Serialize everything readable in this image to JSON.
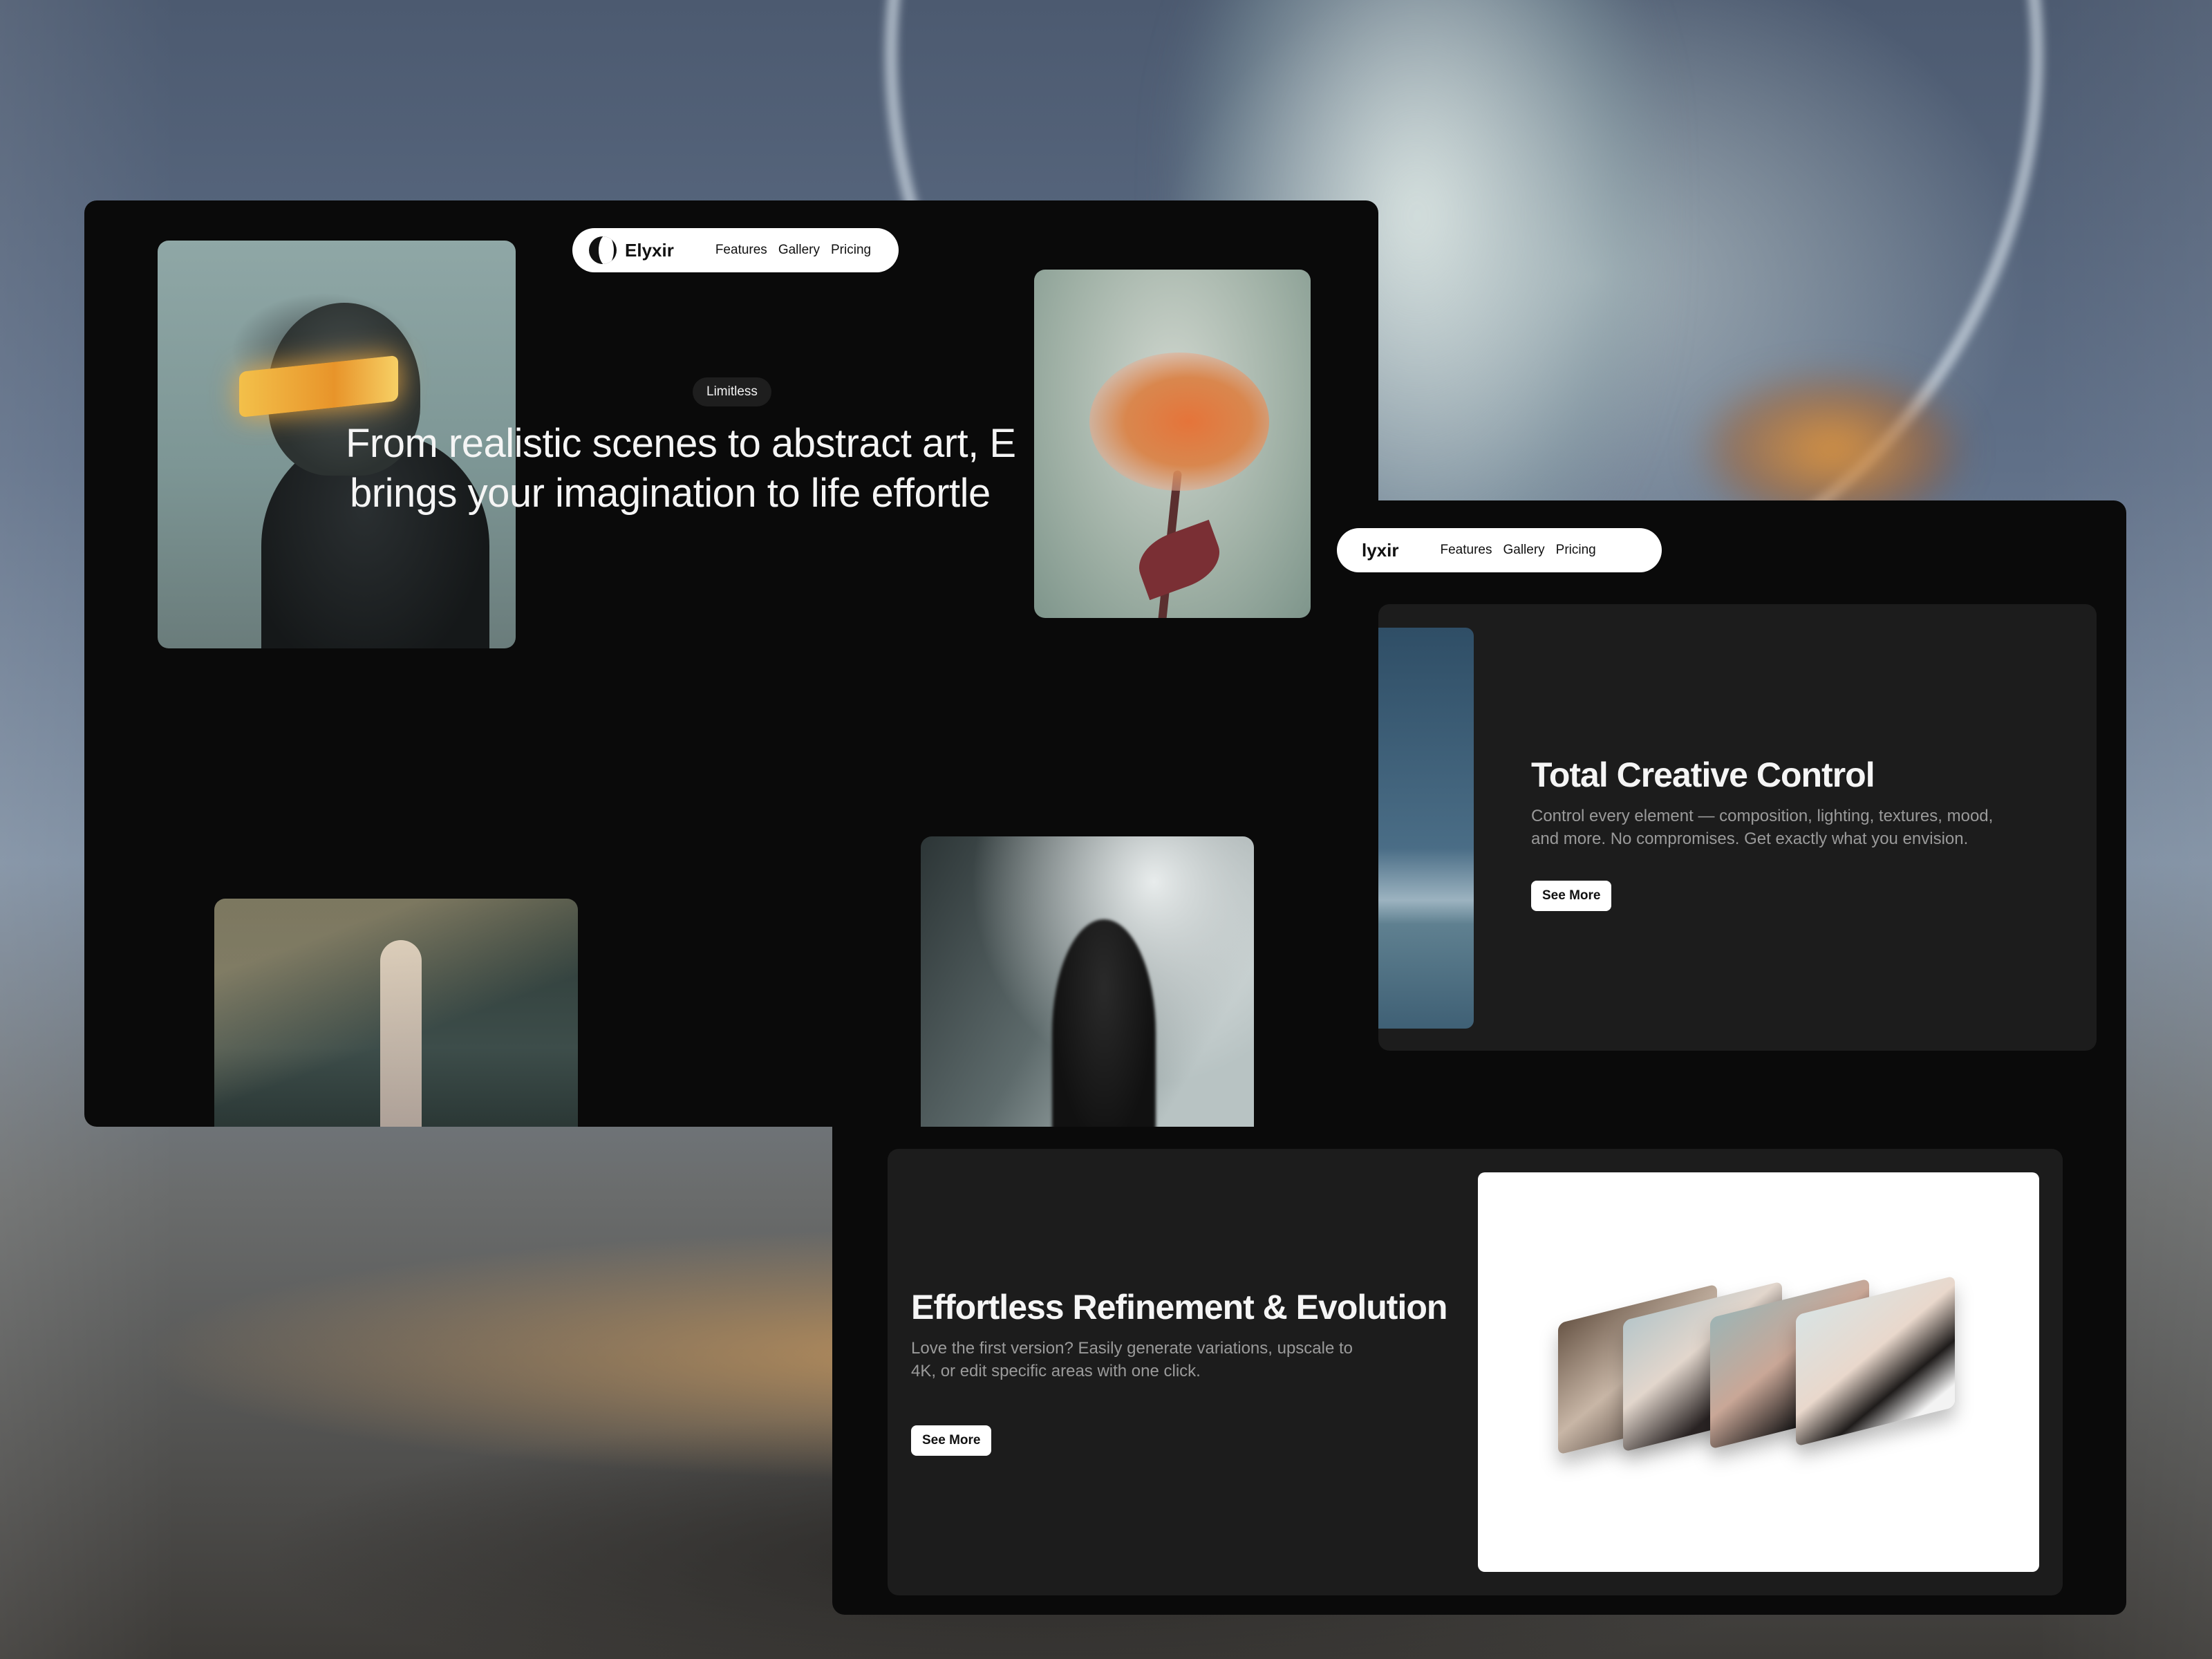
{
  "window_hero": {
    "nav": {
      "brand": "Elyxir",
      "links": [
        "Features",
        "Gallery",
        "Pricing"
      ]
    },
    "badge": "Limitless",
    "headline_line1": "From realistic scenes to abstract art, E",
    "headline_line2": "brings your imagination to life effortle"
  },
  "window_features": {
    "nav": {
      "brand_partial": "lyxir",
      "links": [
        "Features",
        "Gallery",
        "Pricing"
      ]
    },
    "feature_1": {
      "title": "Total Creative Control",
      "description": "Control every element — composition, lighting, textures, mood, and more. No compromises. Get exactly what you envision.",
      "button": "See More"
    },
    "feature_2": {
      "title": "Effortless Refinement & Evolution",
      "description": "Love the first version? Easily generate variations, upscale to 4K, or edit specific areas with one click.",
      "button": "See More"
    }
  },
  "colors": {
    "window_bg": "#0a0a0a",
    "card_bg": "#1c1c1c",
    "text_primary": "#f5f5f5",
    "text_muted": "#9a9a9a",
    "pill_bg": "#ffffff"
  },
  "icons": {
    "logo": "elyxir-logo-icon"
  }
}
